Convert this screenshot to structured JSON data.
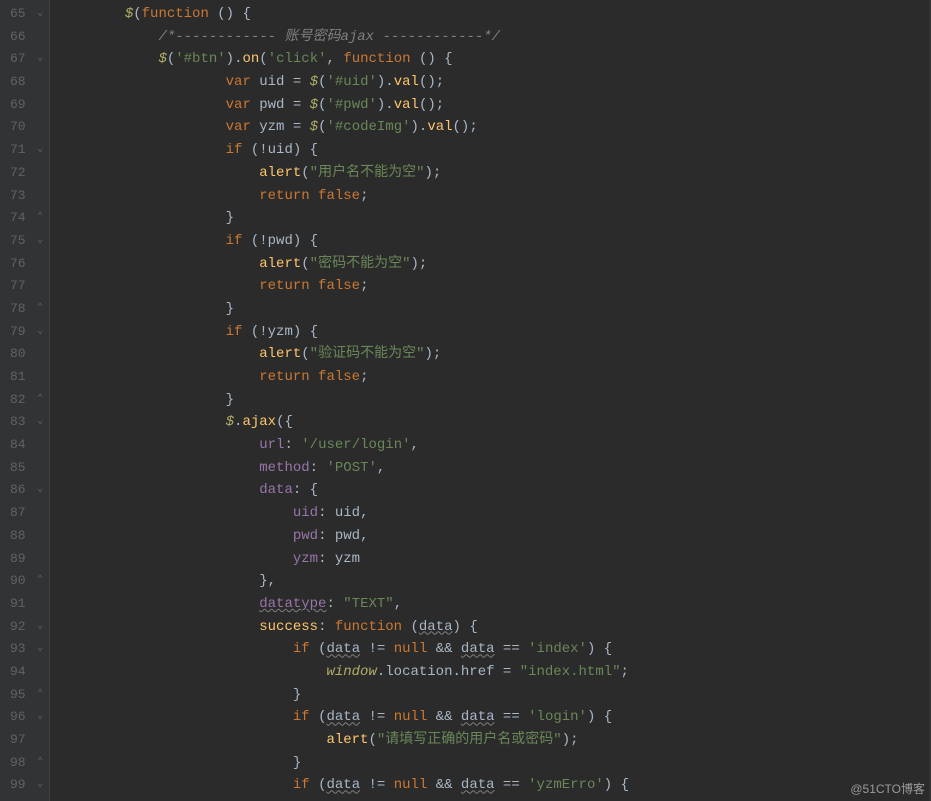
{
  "watermark": "@51CTO博客",
  "gutter": {
    "start": 65,
    "end": 99
  },
  "fold": [
    "⌄",
    "",
    "⌄",
    "",
    "",
    "",
    "⌄",
    "",
    "",
    "⌃",
    "⌄",
    "",
    "",
    "⌃",
    "⌄",
    "",
    "",
    "⌃",
    "⌄",
    "",
    "",
    "⌄",
    "",
    "",
    "",
    "⌃",
    "",
    "⌄",
    "⌄",
    "",
    "⌃",
    "⌄",
    "",
    "⌃",
    "⌄"
  ],
  "code": {
    "l65": {
      "indent": "        ",
      "t": [
        [
          "glb",
          "$"
        ],
        [
          "pn",
          "("
        ],
        [
          "kw",
          "function"
        ],
        [
          "pn",
          " () {"
        ]
      ]
    },
    "l66": {
      "indent": "            ",
      "t": [
        [
          "cmt",
          "/*------------ 账号密码ajax ------------*/"
        ]
      ]
    },
    "l67": {
      "indent": "            ",
      "t": [
        [
          "glb",
          "$"
        ],
        [
          "pn",
          "("
        ],
        [
          "str",
          "'#btn'"
        ],
        [
          "pn",
          ")."
        ],
        [
          "def",
          "on"
        ],
        [
          "pn",
          "("
        ],
        [
          "str",
          "'click'"
        ],
        [
          "pn",
          ", "
        ],
        [
          "kw",
          "function"
        ],
        [
          "pn",
          " () {"
        ]
      ]
    },
    "l68": {
      "indent": "                    ",
      "t": [
        [
          "kw",
          "var "
        ],
        [
          "id",
          "uid = "
        ],
        [
          "glb",
          "$"
        ],
        [
          "pn",
          "("
        ],
        [
          "str",
          "'#uid'"
        ],
        [
          "pn",
          ")."
        ],
        [
          "def",
          "val"
        ],
        [
          "pn",
          "();"
        ]
      ]
    },
    "l69": {
      "indent": "                    ",
      "t": [
        [
          "kw",
          "var "
        ],
        [
          "id",
          "pwd = "
        ],
        [
          "glb",
          "$"
        ],
        [
          "pn",
          "("
        ],
        [
          "str",
          "'#pwd'"
        ],
        [
          "pn",
          ")."
        ],
        [
          "def",
          "val"
        ],
        [
          "pn",
          "();"
        ]
      ]
    },
    "l70": {
      "indent": "                    ",
      "t": [
        [
          "kw",
          "var "
        ],
        [
          "id",
          "yzm = "
        ],
        [
          "glb",
          "$"
        ],
        [
          "pn",
          "("
        ],
        [
          "str",
          "'#codeImg'"
        ],
        [
          "pn",
          ")."
        ],
        [
          "def",
          "val"
        ],
        [
          "pn",
          "();"
        ]
      ]
    },
    "l71": {
      "indent": "                    ",
      "t": [
        [
          "kw",
          "if"
        ],
        [
          "pn",
          " (!uid) {"
        ]
      ]
    },
    "l72": {
      "indent": "                        ",
      "t": [
        [
          "def",
          "alert"
        ],
        [
          "pn",
          "("
        ],
        [
          "str",
          "\"用户名不能为空\""
        ],
        [
          "pn",
          ");"
        ]
      ]
    },
    "l73": {
      "indent": "                        ",
      "t": [
        [
          "kw",
          "return false"
        ],
        [
          "pn",
          ";"
        ]
      ]
    },
    "l74": {
      "indent": "                    ",
      "t": [
        [
          "pn",
          "}"
        ]
      ]
    },
    "l75": {
      "indent": "                    ",
      "t": [
        [
          "kw",
          "if"
        ],
        [
          "pn",
          " (!pwd) {"
        ]
      ]
    },
    "l76": {
      "indent": "                        ",
      "t": [
        [
          "def",
          "alert"
        ],
        [
          "pn",
          "("
        ],
        [
          "str",
          "\"密码不能为空\""
        ],
        [
          "pn",
          ");"
        ]
      ]
    },
    "l77": {
      "indent": "                        ",
      "t": [
        [
          "kw",
          "return false"
        ],
        [
          "pn",
          ";"
        ]
      ]
    },
    "l78": {
      "indent": "                    ",
      "t": [
        [
          "pn",
          "}"
        ]
      ]
    },
    "l79": {
      "indent": "                    ",
      "t": [
        [
          "kw",
          "if"
        ],
        [
          "pn",
          " (!yzm) {"
        ]
      ]
    },
    "l80": {
      "indent": "                        ",
      "t": [
        [
          "def",
          "alert"
        ],
        [
          "pn",
          "("
        ],
        [
          "str",
          "\"验证码不能为空\""
        ],
        [
          "pn",
          ");"
        ]
      ]
    },
    "l81": {
      "indent": "                        ",
      "t": [
        [
          "kw",
          "return false"
        ],
        [
          "pn",
          ";"
        ]
      ]
    },
    "l82": {
      "indent": "                    ",
      "t": [
        [
          "pn",
          "}"
        ]
      ]
    },
    "l83": {
      "indent": "                    ",
      "t": [
        [
          "glb",
          "$"
        ],
        [
          "pn",
          "."
        ],
        [
          "def",
          "ajax"
        ],
        [
          "pn",
          "({"
        ]
      ]
    },
    "l84": {
      "indent": "                        ",
      "t": [
        [
          "prop",
          "url"
        ],
        [
          "pn",
          ": "
        ],
        [
          "str",
          "'/user/login'"
        ],
        [
          "pn",
          ","
        ]
      ]
    },
    "l85": {
      "indent": "                        ",
      "t": [
        [
          "prop",
          "method"
        ],
        [
          "pn",
          ": "
        ],
        [
          "str",
          "'POST'"
        ],
        [
          "pn",
          ","
        ]
      ]
    },
    "l86": {
      "indent": "                        ",
      "t": [
        [
          "prop",
          "data"
        ],
        [
          "pn",
          ": {"
        ]
      ]
    },
    "l87": {
      "indent": "                            ",
      "t": [
        [
          "prop",
          "uid"
        ],
        [
          "pn",
          ": uid,"
        ]
      ]
    },
    "l88": {
      "indent": "                            ",
      "t": [
        [
          "prop",
          "pwd"
        ],
        [
          "pn",
          ": pwd,"
        ]
      ]
    },
    "l89": {
      "indent": "                            ",
      "t": [
        [
          "prop",
          "yzm"
        ],
        [
          "pn",
          ": yzm"
        ]
      ]
    },
    "l90": {
      "indent": "                        ",
      "t": [
        [
          "pn",
          "},"
        ]
      ]
    },
    "l91": {
      "indent": "                        ",
      "t": [
        [
          "prop uwav",
          "datatype"
        ],
        [
          "pn",
          ": "
        ],
        [
          "str",
          "\"TEXT\""
        ],
        [
          "pn",
          ","
        ]
      ]
    },
    "l92": {
      "indent": "                        ",
      "t": [
        [
          "def",
          "success"
        ],
        [
          "pn",
          ": "
        ],
        [
          "kw",
          "function"
        ],
        [
          "pn",
          " ("
        ],
        [
          "id uwav",
          "data"
        ],
        [
          "pn",
          ") {"
        ]
      ]
    },
    "l93": {
      "indent": "                            ",
      "t": [
        [
          "kw",
          "if"
        ],
        [
          "pn",
          " ("
        ],
        [
          "id uwav",
          "data"
        ],
        [
          "pn",
          " != "
        ],
        [
          "kw",
          "null"
        ],
        [
          "pn",
          " && "
        ],
        [
          "id uwav",
          "data"
        ],
        [
          "pn",
          " == "
        ],
        [
          "str",
          "'index'"
        ],
        [
          "pn",
          ") {"
        ]
      ]
    },
    "l94": {
      "indent": "                                ",
      "t": [
        [
          "glb",
          "window"
        ],
        [
          "pn",
          ".location.href = "
        ],
        [
          "str",
          "\"index.html\""
        ],
        [
          "pn",
          ";"
        ]
      ]
    },
    "l95": {
      "indent": "                            ",
      "t": [
        [
          "pn",
          "}"
        ]
      ]
    },
    "l96": {
      "indent": "                            ",
      "t": [
        [
          "kw",
          "if"
        ],
        [
          "pn",
          " ("
        ],
        [
          "id uwav",
          "data"
        ],
        [
          "pn",
          " != "
        ],
        [
          "kw",
          "null"
        ],
        [
          "pn",
          " && "
        ],
        [
          "id uwav",
          "data"
        ],
        [
          "pn",
          " == "
        ],
        [
          "str",
          "'login'"
        ],
        [
          "pn",
          ") {"
        ]
      ]
    },
    "l97": {
      "indent": "                                ",
      "t": [
        [
          "def",
          "alert"
        ],
        [
          "pn",
          "("
        ],
        [
          "str",
          "\"请填写正确的用户名或密码\""
        ],
        [
          "pn",
          ");"
        ]
      ]
    },
    "l98": {
      "indent": "                            ",
      "t": [
        [
          "pn",
          "}"
        ]
      ]
    },
    "l99": {
      "indent": "                            ",
      "t": [
        [
          "kw",
          "if"
        ],
        [
          "pn",
          " ("
        ],
        [
          "id uwav",
          "data"
        ],
        [
          "pn",
          " != "
        ],
        [
          "kw",
          "null"
        ],
        [
          "pn",
          " && "
        ],
        [
          "id uwav",
          "data"
        ],
        [
          "pn",
          " == "
        ],
        [
          "str",
          "'yzmErro'"
        ],
        [
          "pn",
          ") {"
        ]
      ]
    }
  }
}
